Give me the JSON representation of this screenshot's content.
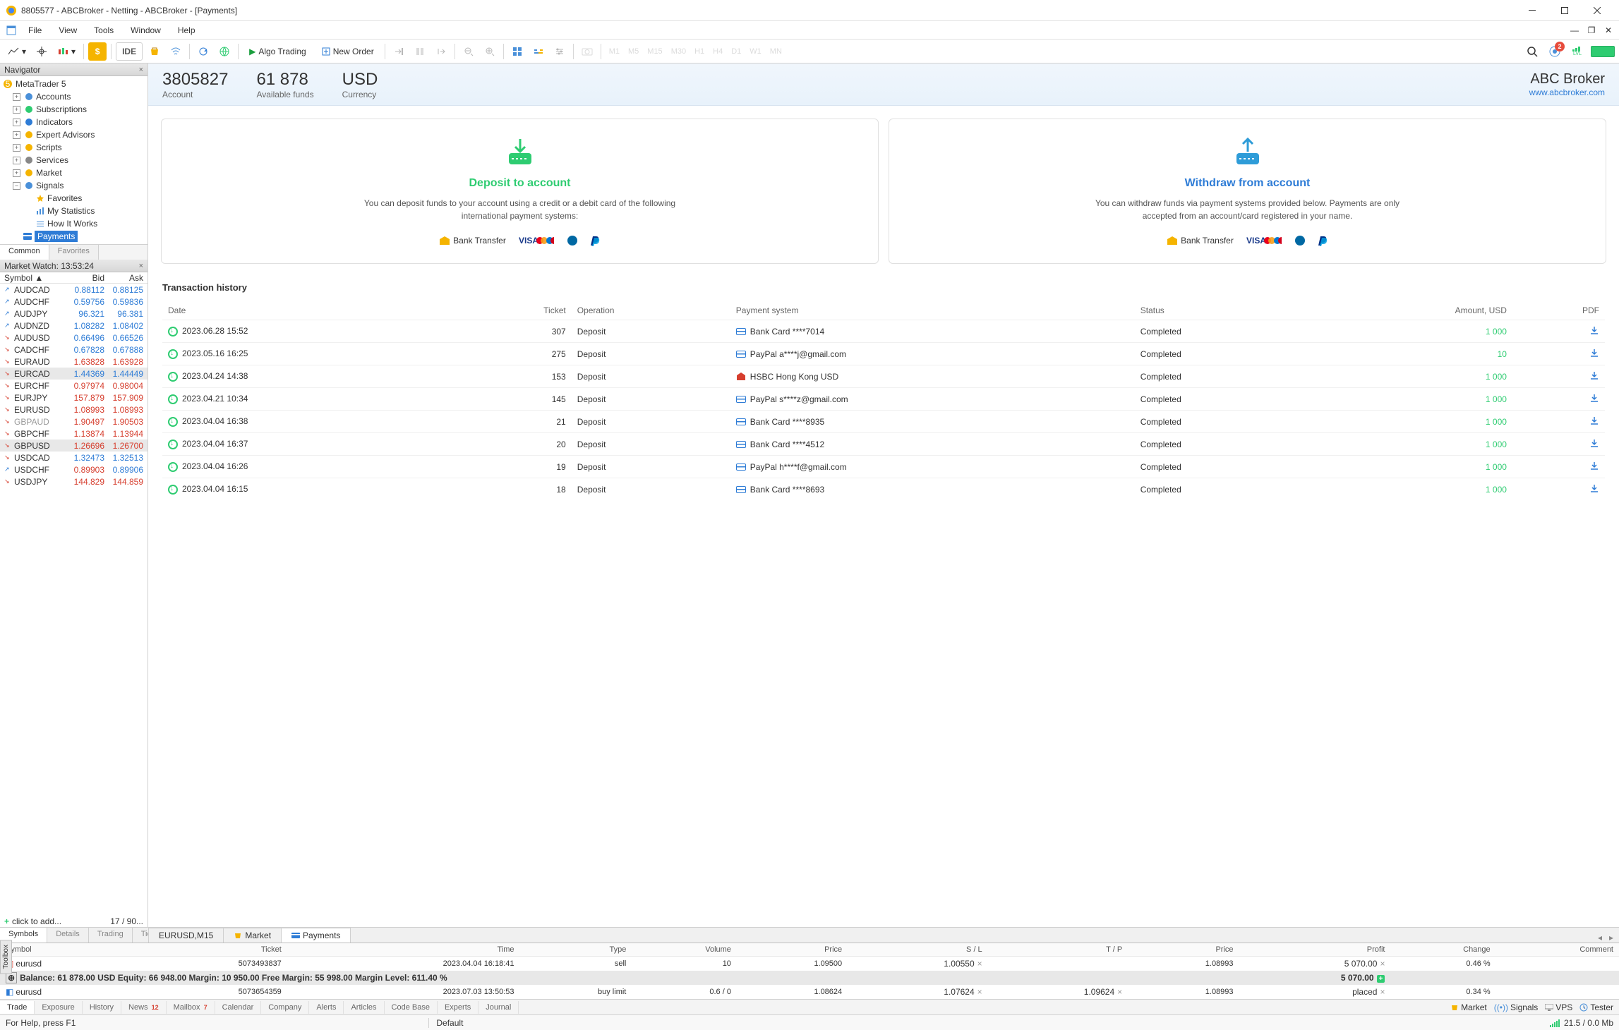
{
  "window": {
    "title": "8805577 - ABCBroker - Netting - ABCBroker - [Payments]"
  },
  "menu": [
    "File",
    "View",
    "Tools",
    "Window",
    "Help"
  ],
  "toolbar": {
    "ide": "IDE",
    "algo": "Algo Trading",
    "neworder": "New Order",
    "timeframes": [
      "M1",
      "M5",
      "M15",
      "M30",
      "H1",
      "H4",
      "D1",
      "W1",
      "MN"
    ],
    "alert_count": "2",
    "lvl": "LVL"
  },
  "navigator": {
    "title": "Navigator",
    "root": "MetaTrader 5",
    "items": [
      "Accounts",
      "Subscriptions",
      "Indicators",
      "Expert Advisors",
      "Scripts",
      "Services",
      "Market",
      "Signals"
    ],
    "signals_children": [
      "Favorites",
      "My Statistics",
      "How It Works"
    ],
    "payments": "Payments",
    "tabs": [
      "Common",
      "Favorites"
    ]
  },
  "marketwatch": {
    "title": "Market Watch: 13:53:24",
    "cols": [
      "Symbol",
      "Bid",
      "Ask"
    ],
    "rows": [
      {
        "d": "up",
        "s": "AUDCAD",
        "b": "0.88112",
        "a": "0.88125",
        "bc": "blue",
        "ac": "blue"
      },
      {
        "d": "up",
        "s": "AUDCHF",
        "b": "0.59756",
        "a": "0.59836",
        "bc": "blue",
        "ac": "blue"
      },
      {
        "d": "up",
        "s": "AUDJPY",
        "b": "96.321",
        "a": "96.381",
        "bc": "blue",
        "ac": "blue"
      },
      {
        "d": "up",
        "s": "AUDNZD",
        "b": "1.08282",
        "a": "1.08402",
        "bc": "blue",
        "ac": "blue"
      },
      {
        "d": "dn",
        "s": "AUDUSD",
        "b": "0.66496",
        "a": "0.66526",
        "bc": "blue",
        "ac": "blue"
      },
      {
        "d": "dn",
        "s": "CADCHF",
        "b": "0.67828",
        "a": "0.67888",
        "bc": "blue",
        "ac": "blue"
      },
      {
        "d": "dn",
        "s": "EURAUD",
        "b": "1.63828",
        "a": "1.63928",
        "bc": "red",
        "ac": "red"
      },
      {
        "d": "dn",
        "s": "EURCAD",
        "b": "1.44369",
        "a": "1.44449",
        "bc": "blue",
        "ac": "blue",
        "hl": true
      },
      {
        "d": "dn",
        "s": "EURCHF",
        "b": "0.97974",
        "a": "0.98004",
        "bc": "red",
        "ac": "red"
      },
      {
        "d": "dn",
        "s": "EURJPY",
        "b": "157.879",
        "a": "157.909",
        "bc": "red",
        "ac": "red"
      },
      {
        "d": "dn",
        "s": "EURUSD",
        "b": "1.08993",
        "a": "1.08993",
        "bc": "red",
        "ac": "red"
      },
      {
        "d": "dn",
        "s": "GBPAUD",
        "b": "1.90497",
        "a": "1.90503",
        "bc": "red",
        "ac": "red",
        "dim": true
      },
      {
        "d": "dn",
        "s": "GBPCHF",
        "b": "1.13874",
        "a": "1.13944",
        "bc": "red",
        "ac": "red"
      },
      {
        "d": "dn",
        "s": "GBPUSD",
        "b": "1.26696",
        "a": "1.26700",
        "bc": "red",
        "ac": "red",
        "hl": true
      },
      {
        "d": "dn",
        "s": "USDCAD",
        "b": "1.32473",
        "a": "1.32513",
        "bc": "blue",
        "ac": "blue"
      },
      {
        "d": "up",
        "s": "USDCHF",
        "b": "0.89903",
        "a": "0.89906",
        "bc": "red",
        "ac": "blue"
      },
      {
        "d": "dn",
        "s": "USDJPY",
        "b": "144.829",
        "a": "144.859",
        "bc": "red",
        "ac": "red"
      }
    ],
    "add": "click to add...",
    "count": "17 / 90...",
    "tabs": [
      "Symbols",
      "Details",
      "Trading",
      "Ticks"
    ]
  },
  "account": {
    "number": "3805827",
    "number_lbl": "Account",
    "funds": "61 878",
    "funds_lbl": "Available funds",
    "ccy": "USD",
    "ccy_lbl": "Currency",
    "broker": "ABC Broker",
    "url": "www.abcbroker.com"
  },
  "deposit": {
    "title": "Deposit to account",
    "text": "You can deposit funds to your account using a credit or a debit card of the following international payment systems:",
    "bank": "Bank Transfer"
  },
  "withdraw": {
    "title": "Withdraw from account",
    "text": "You can withdraw funds via payment systems provided below. Payments are only accepted from an account/card registered in your name.",
    "bank": "Bank Transfer"
  },
  "history": {
    "title": "Transaction history",
    "cols": [
      "Date",
      "Ticket",
      "Operation",
      "Payment system",
      "Status",
      "Amount, USD",
      "PDF"
    ],
    "rows": [
      {
        "date": "2023.06.28 15:52",
        "t": "307",
        "op": "Deposit",
        "ps": "Bank Card ****7014",
        "st": "Completed",
        "amt": "1 000"
      },
      {
        "date": "2023.05.16 16:25",
        "t": "275",
        "op": "Deposit",
        "ps": "PayPal a****j@gmail.com",
        "st": "Completed",
        "amt": "10"
      },
      {
        "date": "2023.04.24 14:38",
        "t": "153",
        "op": "Deposit",
        "ps": "HSBC Hong Kong USD",
        "st": "Completed",
        "amt": "1 000",
        "bank": true
      },
      {
        "date": "2023.04.21 10:34",
        "t": "145",
        "op": "Deposit",
        "ps": "PayPal s****z@gmail.com",
        "st": "Completed",
        "amt": "1 000"
      },
      {
        "date": "2023.04.04 16:38",
        "t": "21",
        "op": "Deposit",
        "ps": "Bank Card ****8935",
        "st": "Completed",
        "amt": "1 000"
      },
      {
        "date": "2023.04.04 16:37",
        "t": "20",
        "op": "Deposit",
        "ps": "Bank Card ****4512",
        "st": "Completed",
        "amt": "1 000"
      },
      {
        "date": "2023.04.04 16:26",
        "t": "19",
        "op": "Deposit",
        "ps": "PayPal h****f@gmail.com",
        "st": "Completed",
        "amt": "1 000"
      },
      {
        "date": "2023.04.04 16:15",
        "t": "18",
        "op": "Deposit",
        "ps": "Bank Card ****8693",
        "st": "Completed",
        "amt": "1 000"
      }
    ]
  },
  "content_tabs": [
    "EURUSD,M15",
    "Market",
    "Payments"
  ],
  "trade": {
    "cols": [
      "Symbol",
      "Ticket",
      "Time",
      "Type",
      "Volume",
      "Price",
      "S / L",
      "T / P",
      "Price",
      "Profit",
      "Change",
      "Comment"
    ],
    "r1": {
      "s": "eurusd",
      "t": "5073493837",
      "tm": "2023.04.04 16:18:41",
      "ty": "sell",
      "v": "10",
      "p": "1.09500",
      "sl": "1.00550",
      "tp": "",
      "p2": "1.08993",
      "pr": "5 070.00",
      "ch": "0.46 %"
    },
    "bal": "Balance: 61 878.00 USD   Equity: 66 948.00   Margin: 10 950.00   Free Margin: 55 998.00   Margin Level: 611.40 %",
    "bal_profit": "5 070.00",
    "r2": {
      "s": "eurusd",
      "t": "5073654359",
      "tm": "2023.07.03 13:50:53",
      "ty": "buy limit",
      "v": "0.6 / 0",
      "p": "1.08624",
      "sl": "1.07624",
      "tp": "1.09624",
      "p2": "1.08993",
      "pr": "placed",
      "ch": "0.34 %"
    }
  },
  "bottom_tabs": [
    "Trade",
    "Exposure",
    "History",
    "News",
    "Mailbox",
    "Calendar",
    "Company",
    "Alerts",
    "Articles",
    "Code Base",
    "Experts",
    "Journal"
  ],
  "bottom_badges": {
    "News": "12",
    "Mailbox": "7"
  },
  "bottom_right": [
    "Market",
    "Signals",
    "VPS",
    "Tester"
  ],
  "status": {
    "help": "For Help, press F1",
    "profile": "Default",
    "net": "21.5 / 0.0 Mb"
  },
  "toolbox": "Toolbox"
}
